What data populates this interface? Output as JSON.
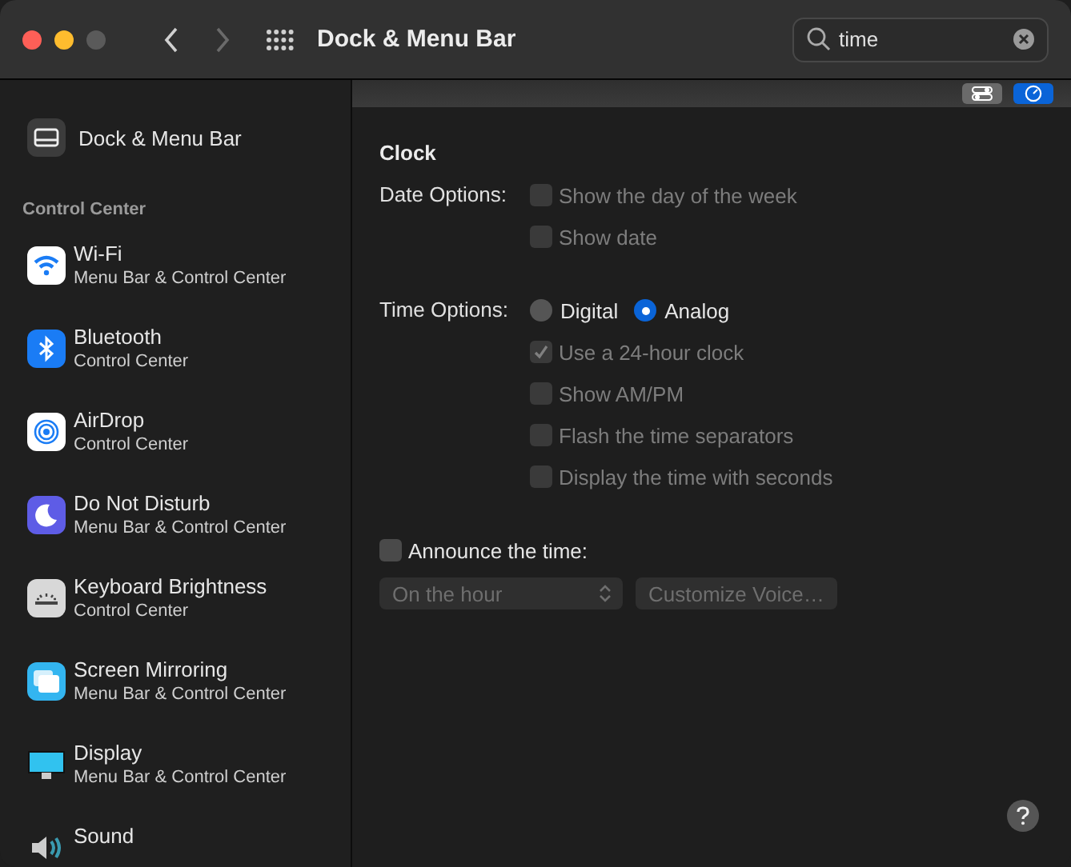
{
  "window": {
    "title": "Dock & Menu Bar"
  },
  "search": {
    "value": "time"
  },
  "view_buttons": [
    {
      "selected": false
    },
    {
      "selected": true
    }
  ],
  "sidebar": {
    "top_item": {
      "label": "Dock & Menu Bar"
    },
    "section": "Control Center",
    "items": [
      {
        "label": "Wi-Fi",
        "subtitle": "Menu Bar & Control Center"
      },
      {
        "label": "Bluetooth",
        "subtitle": "Control Center"
      },
      {
        "label": "AirDrop",
        "subtitle": "Control Center"
      },
      {
        "label": "Do Not Disturb",
        "subtitle": "Menu Bar & Control Center"
      },
      {
        "label": "Keyboard Brightness",
        "subtitle": "Control Center"
      },
      {
        "label": "Screen Mirroring",
        "subtitle": "Menu Bar & Control Center"
      },
      {
        "label": "Display",
        "subtitle": "Menu Bar & Control Center"
      },
      {
        "label": "Sound"
      }
    ]
  },
  "clock": {
    "heading": "Clock",
    "date_options": {
      "label": "Date Options:",
      "checkboxes": [
        {
          "label": "Show the day of the week",
          "checked": false,
          "disabled": true
        },
        {
          "label": "Show date",
          "checked": false,
          "disabled": true
        }
      ]
    },
    "time_options": {
      "label": "Time Options:",
      "radios": [
        {
          "label": "Digital",
          "selected": false
        },
        {
          "label": "Analog",
          "selected": true
        }
      ],
      "checkboxes": [
        {
          "label": "Use a 24-hour clock",
          "checked": true,
          "disabled": true
        },
        {
          "label": "Show AM/PM",
          "checked": false,
          "disabled": true
        },
        {
          "label": "Flash the time separators",
          "checked": false,
          "disabled": true
        },
        {
          "label": "Display the time with seconds",
          "checked": false,
          "disabled": true
        }
      ]
    },
    "announce": {
      "label": "Announce the time:",
      "checked": false
    },
    "interval": {
      "value": "On the hour",
      "disabled": true
    },
    "customize_button": {
      "label": "Customize Voice…",
      "disabled": true
    }
  }
}
